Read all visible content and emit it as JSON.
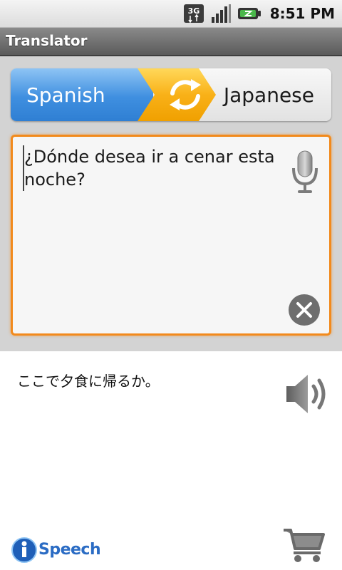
{
  "status_bar": {
    "network": "3G",
    "time": "8:51 PM"
  },
  "app": {
    "title": "Translator"
  },
  "languages": {
    "source": "Spanish",
    "target": "Japanese"
  },
  "input": {
    "text": "¿Dónde desea ir a cenar esta noche?"
  },
  "output": {
    "text": "ここで夕食に帰るか。"
  },
  "footer": {
    "logo_text": "Speech"
  },
  "colors": {
    "accent_orange": "#f28a1c",
    "source_blue": "#3f8fe0",
    "swap_yellow": "#f9b118"
  },
  "icons": {
    "swap": "sync-arrows-icon",
    "mic": "microphone-icon",
    "clear": "clear-circle-icon",
    "speaker": "speaker-icon",
    "cart": "shopping-cart-icon"
  }
}
